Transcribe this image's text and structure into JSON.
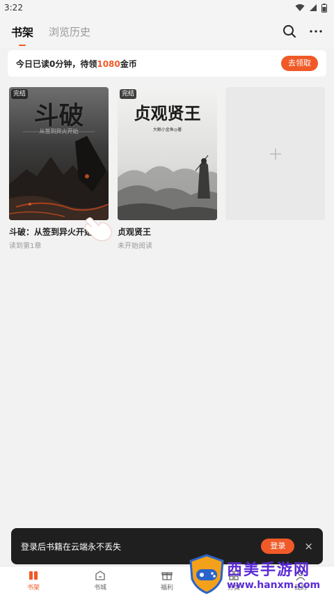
{
  "status_bar": {
    "time": "3:22"
  },
  "header": {
    "tabs": [
      {
        "label": "书架",
        "active": true
      },
      {
        "label": "浏览历史",
        "active": false
      }
    ],
    "icons": [
      "search-icon",
      "more-icon"
    ]
  },
  "reward": {
    "text_before": "今日已读0分钟，待领",
    "amount": "1080",
    "text_after": "金币",
    "button": "去领取"
  },
  "books": [
    {
      "badge": "完结",
      "cover_title": "斗破",
      "cover_subtitle": "从签到异火开始",
      "title": "斗破：从签到异火开始",
      "progress": "读到第1章"
    },
    {
      "badge": "完结",
      "cover_title": "贞观贤王",
      "cover_author": "大鲸小金鱼◎著",
      "title": "贞观贤王",
      "progress": "未开始阅读"
    }
  ],
  "add_slot": {
    "icon": "plus-icon"
  },
  "toast": {
    "text": "登录后书籍在云端永不丢失",
    "button": "登录",
    "close": "×"
  },
  "bottom_nav": [
    {
      "label": "书架",
      "icon": "bookshelf-icon",
      "active": true
    },
    {
      "label": "书城",
      "icon": "bookstore-icon",
      "active": false
    },
    {
      "label": "福利",
      "icon": "gift-icon",
      "active": false
    },
    {
      "label": "分类",
      "icon": "category-icon",
      "active": false
    },
    {
      "label": "我的",
      "icon": "profile-icon",
      "active": false
    }
  ],
  "watermark": {
    "title": "西美手游网",
    "url": "www.hanxm.com"
  },
  "colors": {
    "accent": "#f05a28",
    "background": "#f2f2f2",
    "toast": "#1f1f1f",
    "watermark": "#5b2bd6"
  }
}
